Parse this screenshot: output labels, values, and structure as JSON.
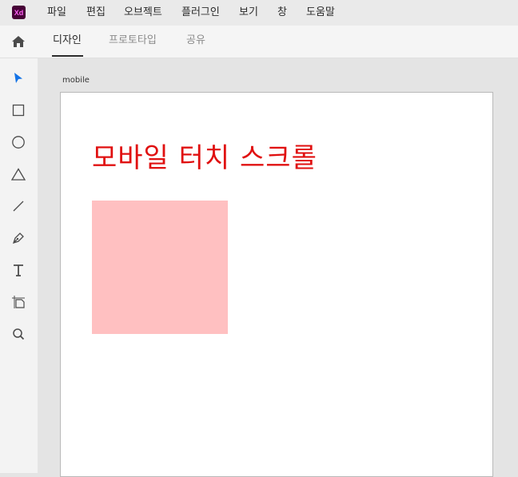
{
  "app": {
    "logo_text": "Xd"
  },
  "menu": [
    "파일",
    "편집",
    "오브젝트",
    "플러그인",
    "보기",
    "창",
    "도움말"
  ],
  "tabs": [
    {
      "label": "디자인",
      "active": true
    },
    {
      "label": "프로토타입",
      "active": false
    },
    {
      "label": "공유",
      "active": false
    }
  ],
  "tools": [
    "select-icon",
    "rectangle-icon",
    "ellipse-icon",
    "polygon-icon",
    "line-icon",
    "pen-icon",
    "text-icon",
    "artboard-icon",
    "zoom-icon"
  ],
  "artboard": {
    "name": "mobile",
    "title": "모바일 터치 스크롤",
    "title_color": "#e01010",
    "rect_color": "#ffc0c1"
  },
  "colors": {
    "accent": "#1473e6",
    "select_tool": "#1473e6"
  }
}
